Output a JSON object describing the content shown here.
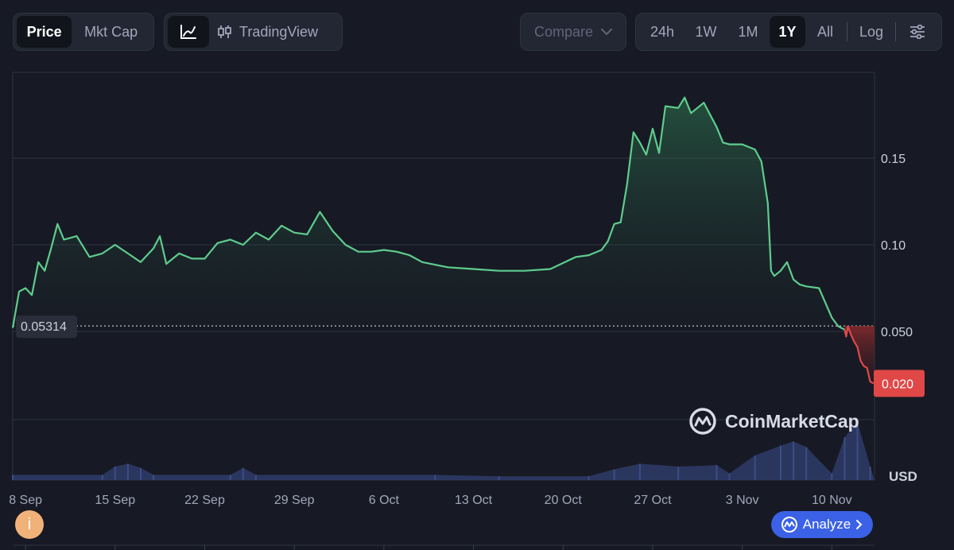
{
  "toolbar": {
    "metric_tabs": [
      {
        "label": "Price",
        "active": true
      },
      {
        "label": "Mkt Cap",
        "active": false
      }
    ],
    "chart_modes": {
      "line_icon": "line-chart-icon",
      "candle_icon": "candlestick-icon",
      "tradingview_label": "TradingView"
    },
    "compare_label": "Compare",
    "ranges": [
      {
        "label": "24h",
        "active": false
      },
      {
        "label": "1W",
        "active": false
      },
      {
        "label": "1M",
        "active": false
      },
      {
        "label": "1Y",
        "active": true
      },
      {
        "label": "All",
        "active": false
      }
    ],
    "log_label": "Log",
    "settings_icon": "sliders-icon"
  },
  "chart_data": {
    "type": "area",
    "currency_label": "USD",
    "y_ticks": [
      0.15,
      0.1,
      0.05
    ],
    "y_tick_labels": [
      "0.15",
      "0.10",
      "0.050"
    ],
    "ylim": [
      0,
      0.2
    ],
    "x_tick_labels": [
      "8 Sep",
      "15 Sep",
      "22 Sep",
      "29 Sep",
      "6 Oct",
      "13 Oct",
      "20 Oct",
      "27 Oct",
      "3 Nov",
      "10 Nov"
    ],
    "x_tick_dates": [
      "2024-09-08",
      "2024-09-15",
      "2024-09-22",
      "2024-09-29",
      "2024-10-06",
      "2024-10-13",
      "2024-10-20",
      "2024-10-27",
      "2024-11-03",
      "2024-11-10"
    ],
    "reference_price": 0.05314,
    "reference_label": "0.05314",
    "current_price": 0.02,
    "current_label": "0.020",
    "up_color": "#5fcc8d",
    "down_color": "#e04848",
    "grid": true,
    "series": [
      {
        "x": [
          "2024-09-07T00:00",
          "2024-09-07T12:00",
          "2024-09-08T00:00",
          "2024-09-08T12:00",
          "2024-09-09T00:00",
          "2024-09-09T12:00",
          "2024-09-10T00:00",
          "2024-09-10T12:00",
          "2024-09-11T00:00",
          "2024-09-12T00:00",
          "2024-09-13T00:00",
          "2024-09-14T00:00",
          "2024-09-15T00:00",
          "2024-09-16T00:00",
          "2024-09-17T00:00",
          "2024-09-18T00:00",
          "2024-09-18T12:00",
          "2024-09-19T00:00",
          "2024-09-20T00:00",
          "2024-09-21T00:00",
          "2024-09-22T00:00",
          "2024-09-23T00:00",
          "2024-09-24T00:00",
          "2024-09-25T00:00",
          "2024-09-26T00:00",
          "2024-09-27T00:00",
          "2024-09-28T00:00",
          "2024-09-29T00:00",
          "2024-09-30T00:00",
          "2024-10-01T00:00",
          "2024-10-02T00:00",
          "2024-10-03T00:00",
          "2024-10-04T00:00",
          "2024-10-05T00:00",
          "2024-10-06T00:00",
          "2024-10-07T00:00",
          "2024-10-08T00:00",
          "2024-10-09T00:00",
          "2024-10-11T00:00",
          "2024-10-13T00:00",
          "2024-10-15T00:00",
          "2024-10-17T00:00",
          "2024-10-19T00:00",
          "2024-10-21T00:00",
          "2024-10-22T00:00",
          "2024-10-23T00:00",
          "2024-10-23T12:00",
          "2024-10-24T00:00",
          "2024-10-24T12:00",
          "2024-10-25T00:00",
          "2024-10-25T12:00",
          "2024-10-26T00:00",
          "2024-10-26T12:00",
          "2024-10-27T00:00",
          "2024-10-27T12:00",
          "2024-10-28T00:00",
          "2024-10-29T00:00",
          "2024-10-29T12:00",
          "2024-10-30T00:00",
          "2024-10-31T00:00",
          "2024-11-01T00:00",
          "2024-11-01T12:00",
          "2024-11-02T00:00",
          "2024-11-03T00:00",
          "2024-11-04T00:00",
          "2024-11-04T12:00",
          "2024-11-05T00:00",
          "2024-11-05T06:00",
          "2024-11-05T12:00",
          "2024-11-06T00:00",
          "2024-11-06T12:00",
          "2024-11-07T00:00",
          "2024-11-07T12:00",
          "2024-11-08T00:00",
          "2024-11-09T00:00",
          "2024-11-10T00:00",
          "2024-11-10T12:00",
          "2024-11-11T00:00"
        ],
        "values": [
          0.052,
          0.073,
          0.075,
          0.071,
          0.09,
          0.085,
          0.098,
          0.112,
          0.103,
          0.105,
          0.093,
          0.095,
          0.1,
          0.095,
          0.09,
          0.098,
          0.105,
          0.089,
          0.095,
          0.092,
          0.092,
          0.101,
          0.103,
          0.1,
          0.107,
          0.103,
          0.111,
          0.107,
          0.106,
          0.119,
          0.108,
          0.1,
          0.096,
          0.096,
          0.097,
          0.096,
          0.094,
          0.09,
          0.087,
          0.086,
          0.085,
          0.085,
          0.086,
          0.093,
          0.094,
          0.097,
          0.102,
          0.112,
          0.113,
          0.135,
          0.165,
          0.159,
          0.152,
          0.167,
          0.153,
          0.18,
          0.179,
          0.185,
          0.176,
          0.182,
          0.168,
          0.159,
          0.158,
          0.158,
          0.155,
          0.148,
          0.124,
          0.085,
          0.082,
          0.085,
          0.09,
          0.08,
          0.077,
          0.076,
          0.075,
          0.058,
          0.053,
          0.051
        ]
      },
      {
        "x": [
          "2024-11-11T00:00",
          "2024-11-11T03:00",
          "2024-11-11T06:00",
          "2024-11-11T12:00",
          "2024-11-11T18:00",
          "2024-11-12T00:00",
          "2024-11-12T06:00",
          "2024-11-12T12:00",
          "2024-11-12T18:00",
          "2024-11-13T00:00",
          "2024-11-13T06:00"
        ],
        "values": [
          0.051,
          0.047,
          0.053,
          0.048,
          0.044,
          0.041,
          0.033,
          0.03,
          0.029,
          0.021,
          0.02
        ]
      }
    ],
    "volume": {
      "x": [
        "2024-09-07",
        "2024-09-14",
        "2024-09-15",
        "2024-09-16",
        "2024-09-17",
        "2024-09-18",
        "2024-09-24",
        "2024-09-25",
        "2024-09-26",
        "2024-10-10",
        "2024-10-15",
        "2024-10-22",
        "2024-10-24",
        "2024-10-26",
        "2024-10-29",
        "2024-11-01",
        "2024-11-02",
        "2024-11-04",
        "2024-11-06",
        "2024-11-07",
        "2024-11-08",
        "2024-11-10",
        "2024-11-11",
        "2024-11-12",
        "2024-11-13"
      ],
      "values": [
        0.2,
        0.2,
        0.8,
        1.0,
        0.7,
        0.2,
        0.2,
        0.7,
        0.2,
        0.2,
        0.1,
        0.1,
        0.6,
        1.0,
        0.8,
        0.9,
        0.3,
        1.6,
        2.3,
        2.6,
        2.2,
        0.3,
        2.9,
        4.0,
        0.8
      ]
    }
  },
  "watermark": {
    "text": "CoinMarketCap",
    "logo_icon": "coinmarketcap-logo-icon"
  },
  "analyze": {
    "label": "Analyze",
    "icon": "analyze-icon",
    "chevron_icon": "chevron-right-icon",
    "color": "#3a61e6"
  },
  "info_button": {
    "label": "i",
    "color": "#f1b27a"
  }
}
